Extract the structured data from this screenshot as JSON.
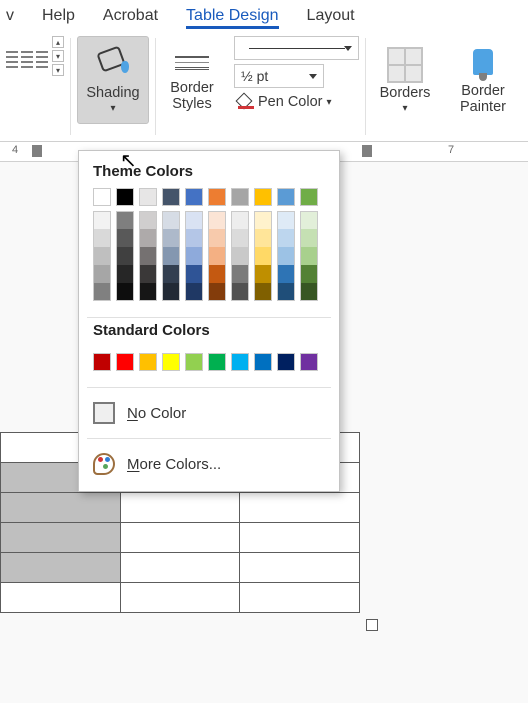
{
  "tabs": {
    "partial": "v",
    "help": "Help",
    "acrobat": "Acrobat",
    "table_design": "Table Design",
    "layout": "Layout"
  },
  "ribbon": {
    "shading_label": "Shading",
    "border_styles_label": "Border\nStyles",
    "borders_label": "Borders",
    "border_painter_label": "Border\nPainter",
    "line_weight": "½ pt",
    "pen_color_label": "Pen Color"
  },
  "ruler": {
    "n4": "4",
    "n7": "7"
  },
  "dropdown": {
    "theme_heading": "Theme Colors",
    "standard_heading": "Standard Colors",
    "no_color_label": "No Color",
    "no_color_key": "N",
    "more_colors_label": "More Colors...",
    "more_colors_key": "M",
    "theme_main": [
      "#ffffff",
      "#000000",
      "#e7e6e6",
      "#44546a",
      "#4472c4",
      "#ed7d31",
      "#a5a5a5",
      "#ffc000",
      "#5b9bd5",
      "#70ad47"
    ],
    "theme_shades": [
      [
        "#f2f2f2",
        "#d9d9d9",
        "#bfbfbf",
        "#a6a6a6",
        "#808080"
      ],
      [
        "#7f7f7f",
        "#595959",
        "#404040",
        "#262626",
        "#0d0d0d"
      ],
      [
        "#d0cece",
        "#aeaaaa",
        "#757171",
        "#3a3838",
        "#161616"
      ],
      [
        "#d6dce5",
        "#adb9ca",
        "#8497b0",
        "#333f50",
        "#222a35"
      ],
      [
        "#d9e2f3",
        "#b4c6e7",
        "#8eaadb",
        "#2f5496",
        "#1f3864"
      ],
      [
        "#fbe4d5",
        "#f7caac",
        "#f4b083",
        "#c45911",
        "#833c0b"
      ],
      [
        "#ededed",
        "#dbdbdb",
        "#c9c9c9",
        "#7b7b7b",
        "#525252"
      ],
      [
        "#fff2cc",
        "#ffe599",
        "#ffd966",
        "#bf8f00",
        "#806000"
      ],
      [
        "#deeaf6",
        "#bdd6ee",
        "#9cc2e5",
        "#2e74b5",
        "#1f4e79"
      ],
      [
        "#e2efd9",
        "#c5e0b3",
        "#a8d08d",
        "#538135",
        "#375623"
      ]
    ],
    "standard": [
      "#c00000",
      "#ff0000",
      "#ffc000",
      "#ffff00",
      "#92d050",
      "#00b050",
      "#00b0f0",
      "#0070c0",
      "#002060",
      "#7030a0"
    ]
  }
}
